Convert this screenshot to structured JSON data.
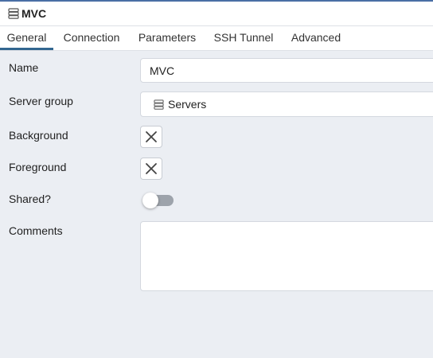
{
  "dialog": {
    "title": "MVC",
    "title_icon": "server-icon"
  },
  "tabs": [
    {
      "label": "General",
      "active": true
    },
    {
      "label": "Connection",
      "active": false
    },
    {
      "label": "Parameters",
      "active": false
    },
    {
      "label": "SSH Tunnel",
      "active": false
    },
    {
      "label": "Advanced",
      "active": false
    }
  ],
  "form": {
    "name_label": "Name",
    "name_value": "MVC",
    "server_group_label": "Server group",
    "server_group_value": "Servers",
    "server_group_icon": "server-group-icon",
    "background_label": "Background",
    "foreground_label": "Foreground",
    "shared_label": "Shared?",
    "shared_value": false,
    "comments_label": "Comments",
    "comments_value": ""
  },
  "colors": {
    "accent": "#326690",
    "background": "#ebeef3"
  }
}
